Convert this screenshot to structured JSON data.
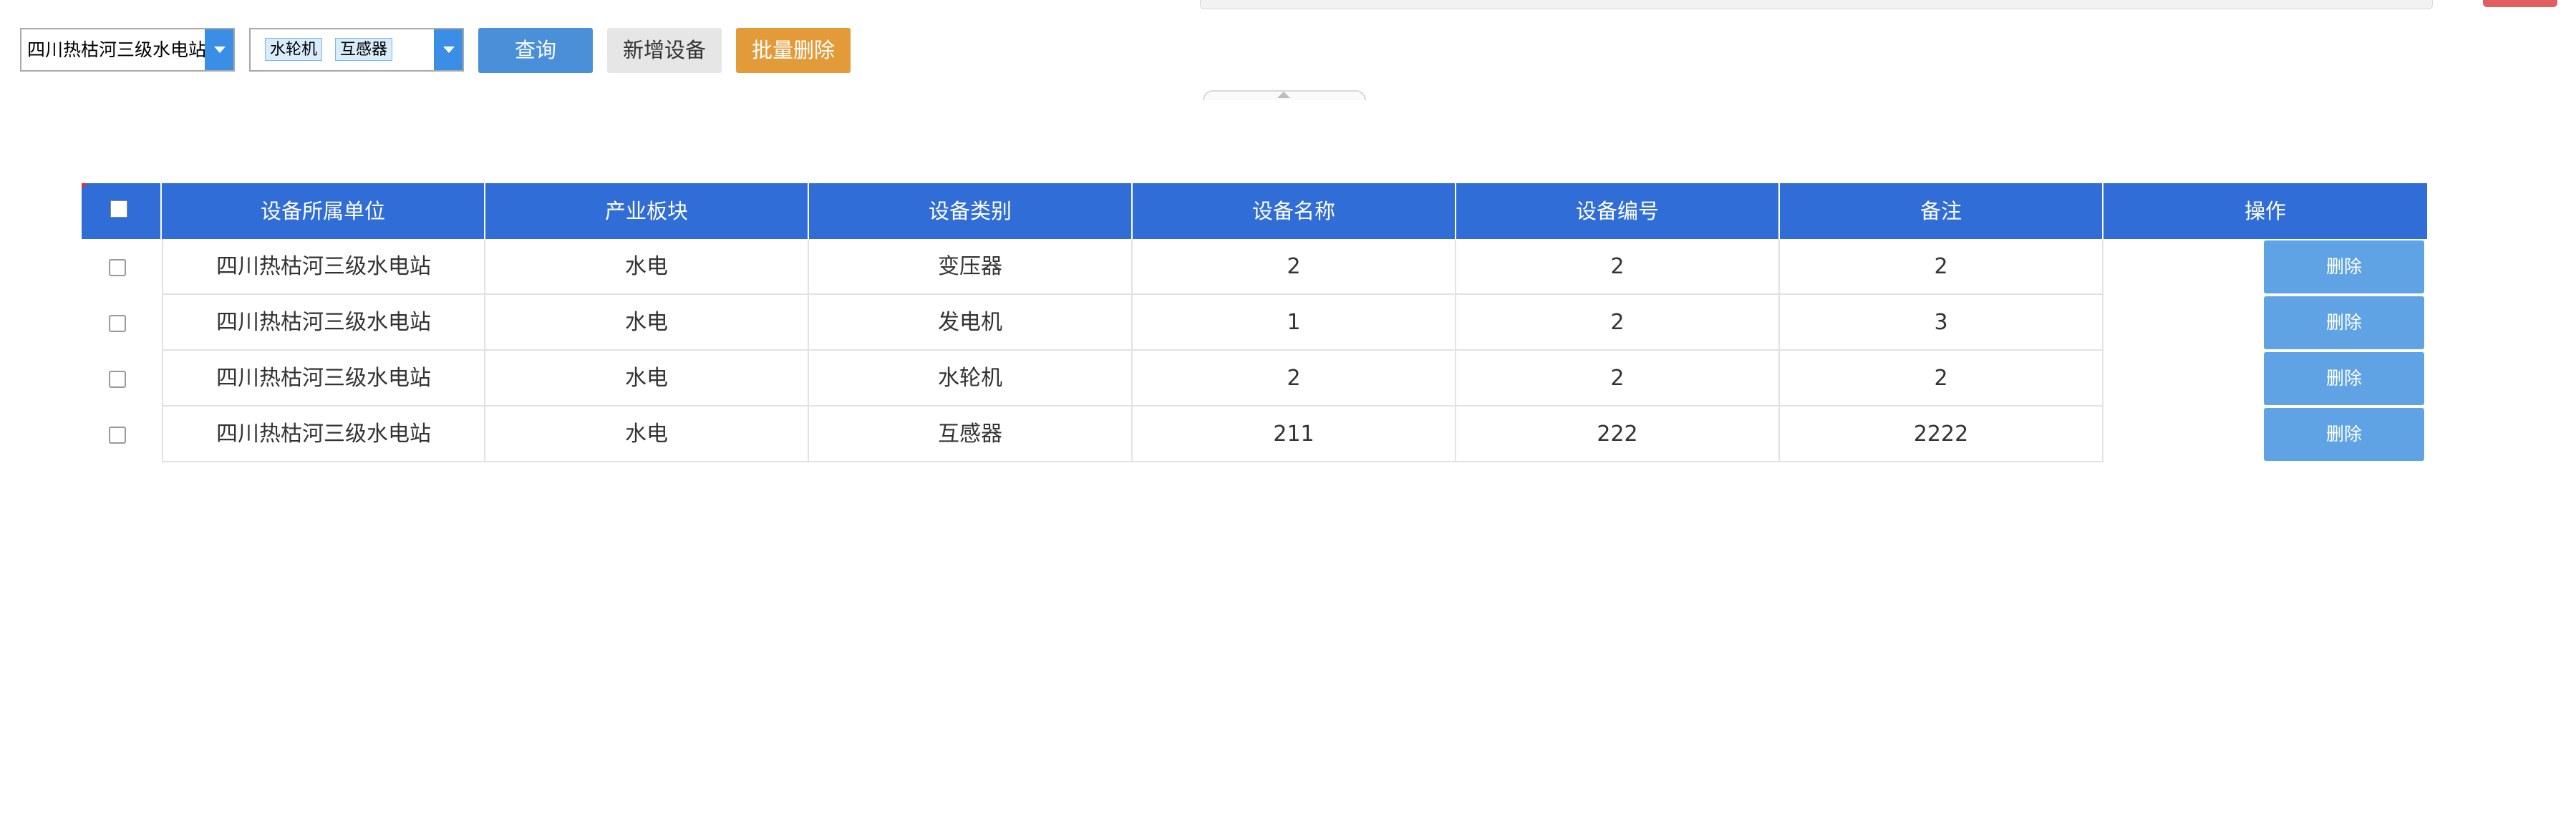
{
  "toolbar": {
    "unit_select": {
      "value": "四川热枯河三级水电站"
    },
    "category_select": {
      "tags": [
        "水轮机",
        "互感器"
      ]
    },
    "query_label": "查询",
    "add_label": "新增设备",
    "batch_delete_label": "批量删除"
  },
  "table": {
    "columns": [
      "设备所属单位",
      "产业板块",
      "设备类别",
      "设备名称",
      "设备编号",
      "备注",
      "操作"
    ],
    "rows": [
      {
        "unit": "四川热枯河三级水电站",
        "sector": "水电",
        "category": "变压器",
        "name": "2",
        "code": "2",
        "remark": "2",
        "action": "删除"
      },
      {
        "unit": "四川热枯河三级水电站",
        "sector": "水电",
        "category": "发电机",
        "name": "1",
        "code": "2",
        "remark": "3",
        "action": "删除"
      },
      {
        "unit": "四川热枯河三级水电站",
        "sector": "水电",
        "category": "水轮机",
        "name": "2",
        "code": "2",
        "remark": "2",
        "action": "删除"
      },
      {
        "unit": "四川热枯河三级水电站",
        "sector": "水电",
        "category": "互感器",
        "name": "211",
        "code": "222",
        "remark": "2222",
        "action": "删除"
      }
    ]
  },
  "colors": {
    "header_bg": "#306dd6",
    "query_btn": "#4a90d9",
    "batch_delete_btn": "#e39b3a",
    "row_delete_btn": "#5fa3e5"
  }
}
